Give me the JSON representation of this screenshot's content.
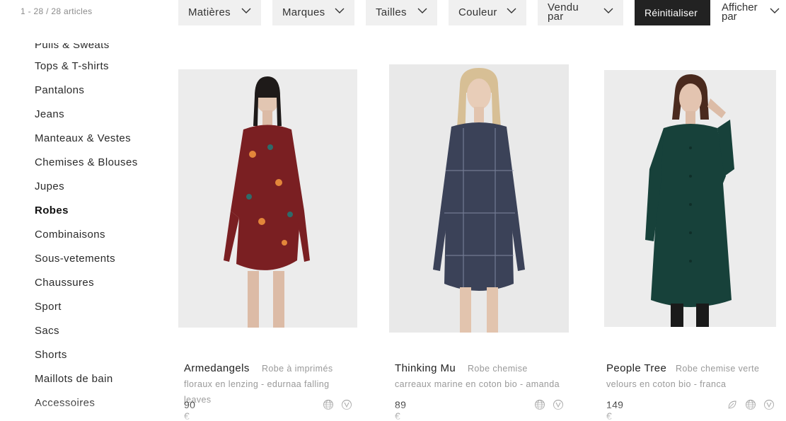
{
  "results_count": "1 - 28 / 28 articles",
  "sidebar": {
    "items": [
      {
        "label": "Pulls & Sweats",
        "active": false
      },
      {
        "label": "Tops & T-shirts",
        "active": false
      },
      {
        "label": "Pantalons",
        "active": false
      },
      {
        "label": "Jeans",
        "active": false
      },
      {
        "label": "Manteaux & Vestes",
        "active": false
      },
      {
        "label": "Chemises & Blouses",
        "active": false
      },
      {
        "label": "Jupes",
        "active": false
      },
      {
        "label": "Robes",
        "active": true
      },
      {
        "label": "Combinaisons",
        "active": false
      },
      {
        "label": "Sous-vetements",
        "active": false
      },
      {
        "label": "Chaussures",
        "active": false
      },
      {
        "label": "Sport",
        "active": false
      },
      {
        "label": "Sacs",
        "active": false
      },
      {
        "label": "Shorts",
        "active": false
      },
      {
        "label": "Maillots de bain",
        "active": false
      },
      {
        "label": "Accessoires",
        "active": false
      }
    ]
  },
  "filters": {
    "matieres": "Matières",
    "marques": "Marques",
    "tailles": "Tailles",
    "couleur": "Couleur",
    "vendu_par": "Vendu par",
    "reset": "Réinitialiser",
    "afficher_par": "Afficher par",
    "chevron_icon": "chevron-down-icon"
  },
  "products": [
    {
      "brand": "Armedangels",
      "description": "Robe à imprimés floraux en lenzing - edurnaa falling leaves",
      "price": "90 €",
      "dress_color": "#7a1f22",
      "badges": [
        "globe-icon",
        "vegan-icon"
      ]
    },
    {
      "brand": "Thinking Mu",
      "description": "Robe chemise carreaux marine en coton bio - amanda",
      "price": "89 €",
      "dress_color": "#3b4258",
      "badges": [
        "globe-icon",
        "vegan-icon"
      ]
    },
    {
      "brand": "People Tree",
      "description": "Robe chemise verte velours en coton bio - franca",
      "price": "149 €",
      "dress_color": "#17413a",
      "badges": [
        "leaf-icon",
        "globe-icon",
        "vegan-icon"
      ]
    }
  ],
  "colors": {
    "filter_bg": "#f0f0f0",
    "reset_bg": "#222222",
    "muted_text": "#999999"
  }
}
